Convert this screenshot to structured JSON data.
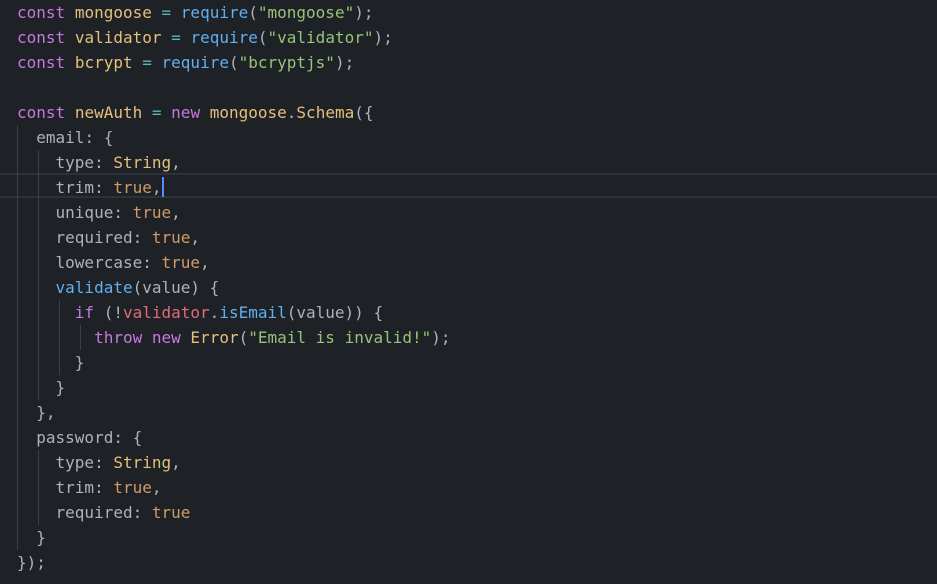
{
  "colors": {
    "background": "#1e2227",
    "keyword": "#c678dd",
    "function": "#61afef",
    "string": "#98c379",
    "constant": "#d19a66",
    "class": "#e5c07b",
    "text": "#abb2bf",
    "variable_error": "#e06c75",
    "cursor": "#528bff"
  },
  "code": {
    "l1": [
      "const",
      "mongoose",
      "=",
      "require",
      "(",
      "\"mongoose\"",
      ");"
    ],
    "l2": [
      "const",
      "validator",
      "=",
      "require",
      "(",
      "\"validator\"",
      ");"
    ],
    "l3": [
      "const",
      "bcrypt",
      "=",
      "require",
      "(",
      "\"bcryptjs\"",
      ");"
    ],
    "l5": [
      "const",
      "newAuth",
      "=",
      "new",
      "mongoose",
      ".",
      "Schema",
      "({"
    ],
    "l6": [
      "email",
      ":",
      "{"
    ],
    "l7": [
      "type",
      ":",
      "String",
      ","
    ],
    "l8": [
      "trim",
      ":",
      "true",
      ","
    ],
    "l9": [
      "unique",
      ":",
      "true",
      ","
    ],
    "l10": [
      "required",
      ":",
      "true",
      ","
    ],
    "l11": [
      "lowercase",
      ":",
      "true",
      ","
    ],
    "l12": [
      "validate",
      "(value)",
      "{"
    ],
    "l13": [
      "if",
      "(!",
      "validator",
      ".",
      "isEmail",
      "(value))",
      "{"
    ],
    "l14": [
      "throw",
      "new",
      "Error",
      "(",
      "\"Email is invalid!\"",
      ");"
    ],
    "l15": [
      "}"
    ],
    "l16": [
      "}"
    ],
    "l17": [
      "},"
    ],
    "l18": [
      "password",
      ":",
      "{"
    ],
    "l19": [
      "type",
      ":",
      "String",
      ","
    ],
    "l20": [
      "trim",
      ":",
      "true",
      ","
    ],
    "l21": [
      "required",
      ":",
      "true"
    ],
    "l22": [
      "}"
    ],
    "l23": [
      "});"
    ]
  }
}
